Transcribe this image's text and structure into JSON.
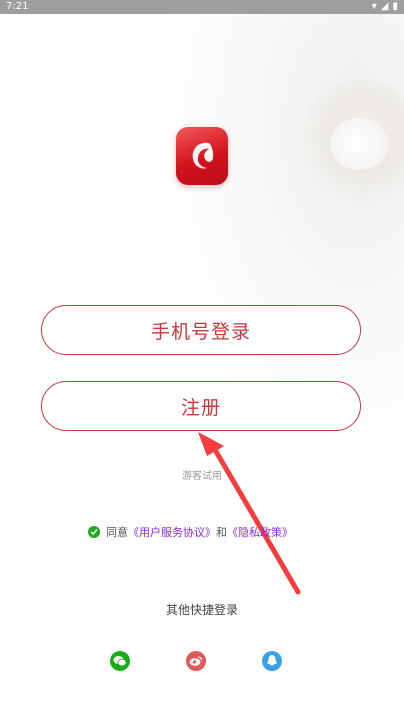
{
  "status_bar": {
    "time": "7:21"
  },
  "auth": {
    "phone_login_label": "手机号登录",
    "register_label": "注册",
    "guest_label": "游客试用"
  },
  "agreement": {
    "prefix": "同意",
    "user_agreement": "《用户服务协议》",
    "conjunction": "和",
    "privacy_policy": "《隐私政策》"
  },
  "other_login": {
    "title": "其他快捷登录",
    "options": [
      "wechat-icon",
      "weibo-icon",
      "qq-icon"
    ]
  },
  "colors": {
    "accent": "#c9383c",
    "status_bar": "#9e9e9e",
    "wechat": "#1aad19",
    "weibo": "#e4575a",
    "qq": "#3aa0e8",
    "link": "#8a2be2"
  }
}
